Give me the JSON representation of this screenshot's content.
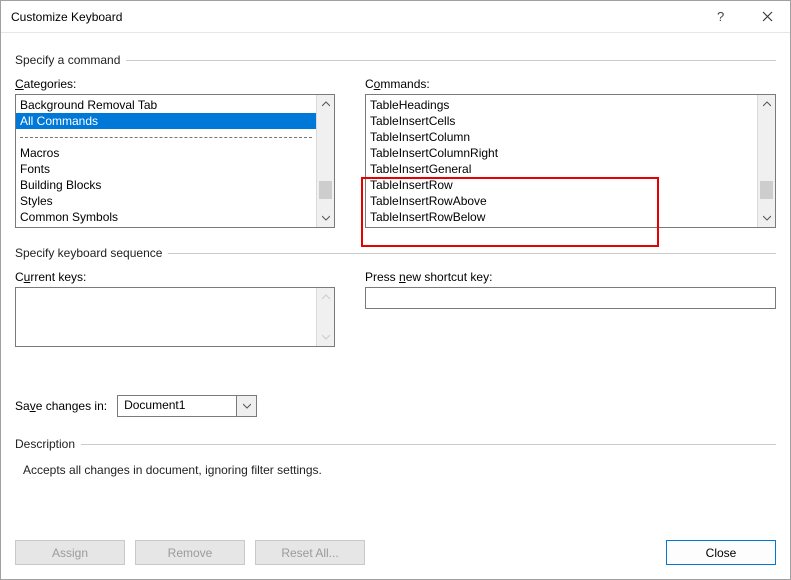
{
  "title": "Customize Keyboard",
  "sections": {
    "specify_command": "Specify a command",
    "specify_sequence": "Specify keyboard sequence",
    "description": "Description"
  },
  "labels": {
    "categories": "Categories:",
    "commands": "Commands:",
    "current_keys": "Current keys:",
    "press_new": "Press new shortcut key:",
    "save_changes_pre": "Sa",
    "save_changes_u": "v",
    "save_changes_post": "e changes in:"
  },
  "categories": {
    "items": [
      "Background Removal Tab",
      "All Commands",
      "__separator__",
      "Macros",
      "Fonts",
      "Building Blocks",
      "Styles",
      "Common Symbols"
    ],
    "selected_index": 1
  },
  "commands": {
    "items": [
      "TableHeadings",
      "TableInsertCells",
      "TableInsertColumn",
      "TableInsertColumnRight",
      "TableInsertGeneral",
      "TableInsertRow",
      "TableInsertRowAbove",
      "TableInsertRowBelow"
    ]
  },
  "save_in": "Document1",
  "description_text": "Accepts all changes in document, ignoring filter settings.",
  "buttons": {
    "assign": "Assign",
    "remove": "Remove",
    "reset": "Reset All...",
    "close": "Close"
  },
  "accessible": {
    "categories_u": "C",
    "commands_u": "o",
    "current_u": "u",
    "new_u": "n"
  }
}
